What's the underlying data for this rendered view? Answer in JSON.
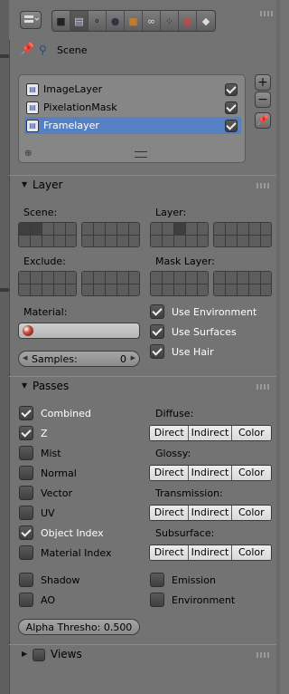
{
  "context": {
    "scene_label": "Scene"
  },
  "render_layers": {
    "items": [
      {
        "label": "ImageLayer",
        "enabled": true,
        "selected": false
      },
      {
        "label": "PixelationMask",
        "enabled": true,
        "selected": false
      },
      {
        "label": "Framelayer",
        "enabled": true,
        "selected": true
      }
    ],
    "side_buttons": {
      "add": "+",
      "remove": "−"
    }
  },
  "layer_panel": {
    "title": "Layer",
    "scene_label": "Scene:",
    "layer_label": "Layer:",
    "exclude_label": "Exclude:",
    "mask_layer_label": "Mask Layer:",
    "material_label": "Material:",
    "samples_label": "Samples:",
    "samples_value": "0",
    "use_environment": {
      "label": "Use Environment",
      "checked": true
    },
    "use_surfaces": {
      "label": "Use Surfaces",
      "checked": true
    },
    "use_hair": {
      "label": "Use Hair",
      "checked": true
    }
  },
  "passes_panel": {
    "title": "Passes",
    "left_passes": [
      {
        "label": "Combined",
        "checked": true
      },
      {
        "label": "Z",
        "checked": true
      },
      {
        "label": "Mist",
        "checked": false
      },
      {
        "label": "Normal",
        "checked": false
      },
      {
        "label": "Vector",
        "checked": false
      },
      {
        "label": "UV",
        "checked": false
      },
      {
        "label": "Object Index",
        "checked": true
      },
      {
        "label": "Material Index",
        "checked": false
      }
    ],
    "groups": [
      {
        "label": "Diffuse:"
      },
      {
        "label": "Glossy:"
      },
      {
        "label": "Transmission:"
      },
      {
        "label": "Subsurface:"
      }
    ],
    "segment_labels": {
      "direct": "Direct",
      "indirect": "Indirect",
      "color": "Color"
    },
    "shadow": {
      "label": "Shadow",
      "checked": false
    },
    "ao": {
      "label": "AO",
      "checked": false
    },
    "emission": {
      "label": "Emission",
      "checked": false
    },
    "environment": {
      "label": "Environment",
      "checked": false
    },
    "alpha_threshold": "Alpha Thresho: 0.500"
  },
  "views_panel": {
    "title": "Views",
    "checked": false
  }
}
